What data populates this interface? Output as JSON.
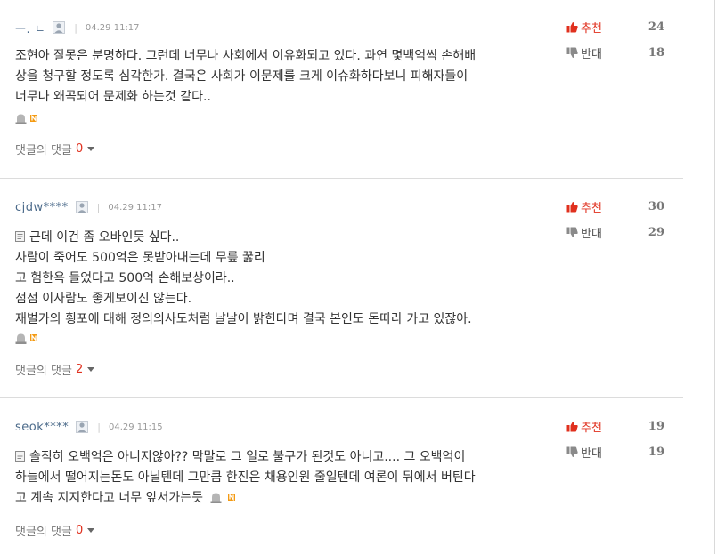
{
  "comments": [
    {
      "user": "ㅡ. ㄴ",
      "date": "04.29 11:17",
      "lines": [
        "조현아 잘못은 분명하다. 그런데 너무나 사회에서 이유화되고 있다. 과연 몇백억씩 손해배",
        "상을 청구할 정도록 심각한가. 결국은 사회가 이문제를 크게 이슈화하다보니 피해자들이",
        "너무나 왜곡되어 문제화 하는것 같다.."
      ],
      "recommend_label": "추천",
      "recommend_count": "24",
      "oppose_label": "반대",
      "oppose_count": "18",
      "reply_label": "댓글의 댓글",
      "reply_count": "0"
    },
    {
      "user": "cjdw****",
      "date": "04.29 11:17",
      "lines": [
        "근데 이건 좀 오바인듯 싶다..",
        "사람이 죽어도 500억은 못받아내는데 무릎 꿇리",
        "고 험한욕 들었다고 500억 손해보상이라..",
        "점점 이사람도 좋게보이진 않는다.",
        "재벌가의 횡포에 대해 정의의사도처럼 날날이 밝힌다며 결국 본인도 돈따라 가고 있잖아."
      ],
      "recommend_label": "추천",
      "recommend_count": "30",
      "oppose_label": "반대",
      "oppose_count": "29",
      "reply_label": "댓글의 댓글",
      "reply_count": "2"
    },
    {
      "user": "seok****",
      "date": "04.29 11:15",
      "lines": [
        "솔직히 오백억은 아니지않아?? 막말로 그 일로 불구가 된것도 아니고.... 그 오백억이",
        "하늘에서 떨어지는돈도 아닐텐데 그만큼 한진은 채용인원 줄일텐데 여론이 뒤에서 버틴다",
        "고 계속 지지한다고 너무 앞서가는듯"
      ],
      "recommend_label": "추천",
      "recommend_count": "19",
      "oppose_label": "반대",
      "oppose_count": "19",
      "reply_label": "댓글의 댓글",
      "reply_count": "0"
    }
  ],
  "colors": {
    "accent": "#e0301e",
    "username": "#4b6a8a",
    "divider": "#dcdcdc"
  },
  "icons": {
    "user": "user-silhouette-icon",
    "memo": "memo-icon",
    "alert": "alert-bell-icon",
    "new": "new-badge-icon",
    "recommend": "thumbs-up-icon",
    "oppose": "thumbs-down-icon"
  }
}
